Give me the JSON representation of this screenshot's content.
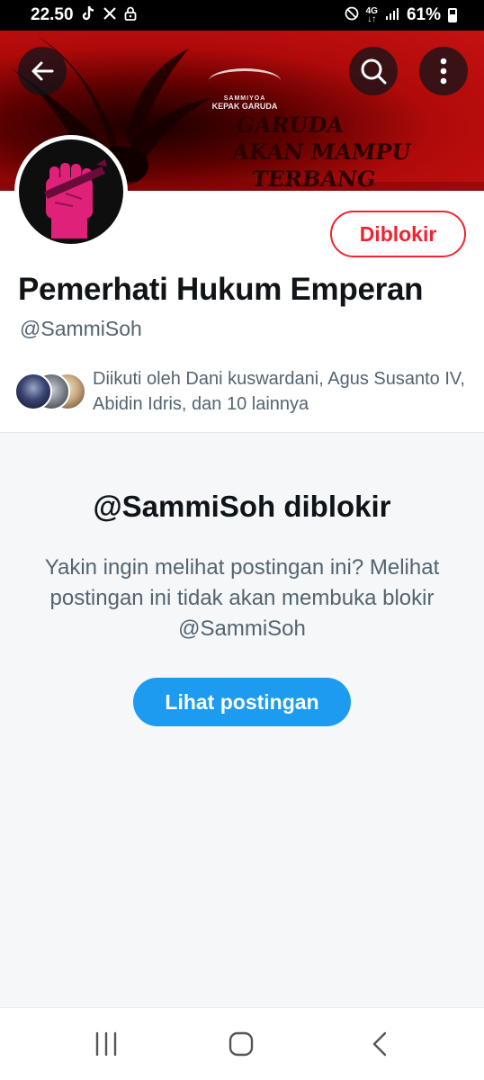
{
  "status_bar": {
    "time": "22.50",
    "network_top": "4G",
    "network_bottom": "↓↑",
    "battery": "61%"
  },
  "banner": {
    "logo_text": "KEPAK GARUDA",
    "logo_arc": "SAMMIYOA",
    "line1": "GARUDA",
    "line2": "AKAN MAMPU",
    "line3": "TERBANG TINGGI!"
  },
  "profile": {
    "display_name": "Pemerhati Hukum Emperan",
    "handle": "@SammiSoh",
    "blocked_label": "Diblokir",
    "followed_by": "Diikuti oleh Dani kuswardani, Agus Susanto IV, Abidin Idris, dan 10 lainnya"
  },
  "blocked_panel": {
    "title": "@SammiSoh diblokir",
    "description": "Yakin ingin melihat postingan ini? Melihat postingan ini tidak akan membuka blokir @SammiSoh",
    "button_label": "Lihat postingan"
  },
  "colors": {
    "accent": "#1d9bf0",
    "blocked_red": "#f4212e",
    "banner_red": "#c41212",
    "avatar_pink": "#e0217a"
  },
  "icons": [
    "tiktok-icon",
    "x-icon",
    "lock-icon",
    "dnd-icon",
    "signal-icon",
    "battery-icon",
    "back-arrow-icon",
    "search-icon",
    "more-icon",
    "recent-apps-icon",
    "home-icon",
    "nav-back-icon"
  ]
}
